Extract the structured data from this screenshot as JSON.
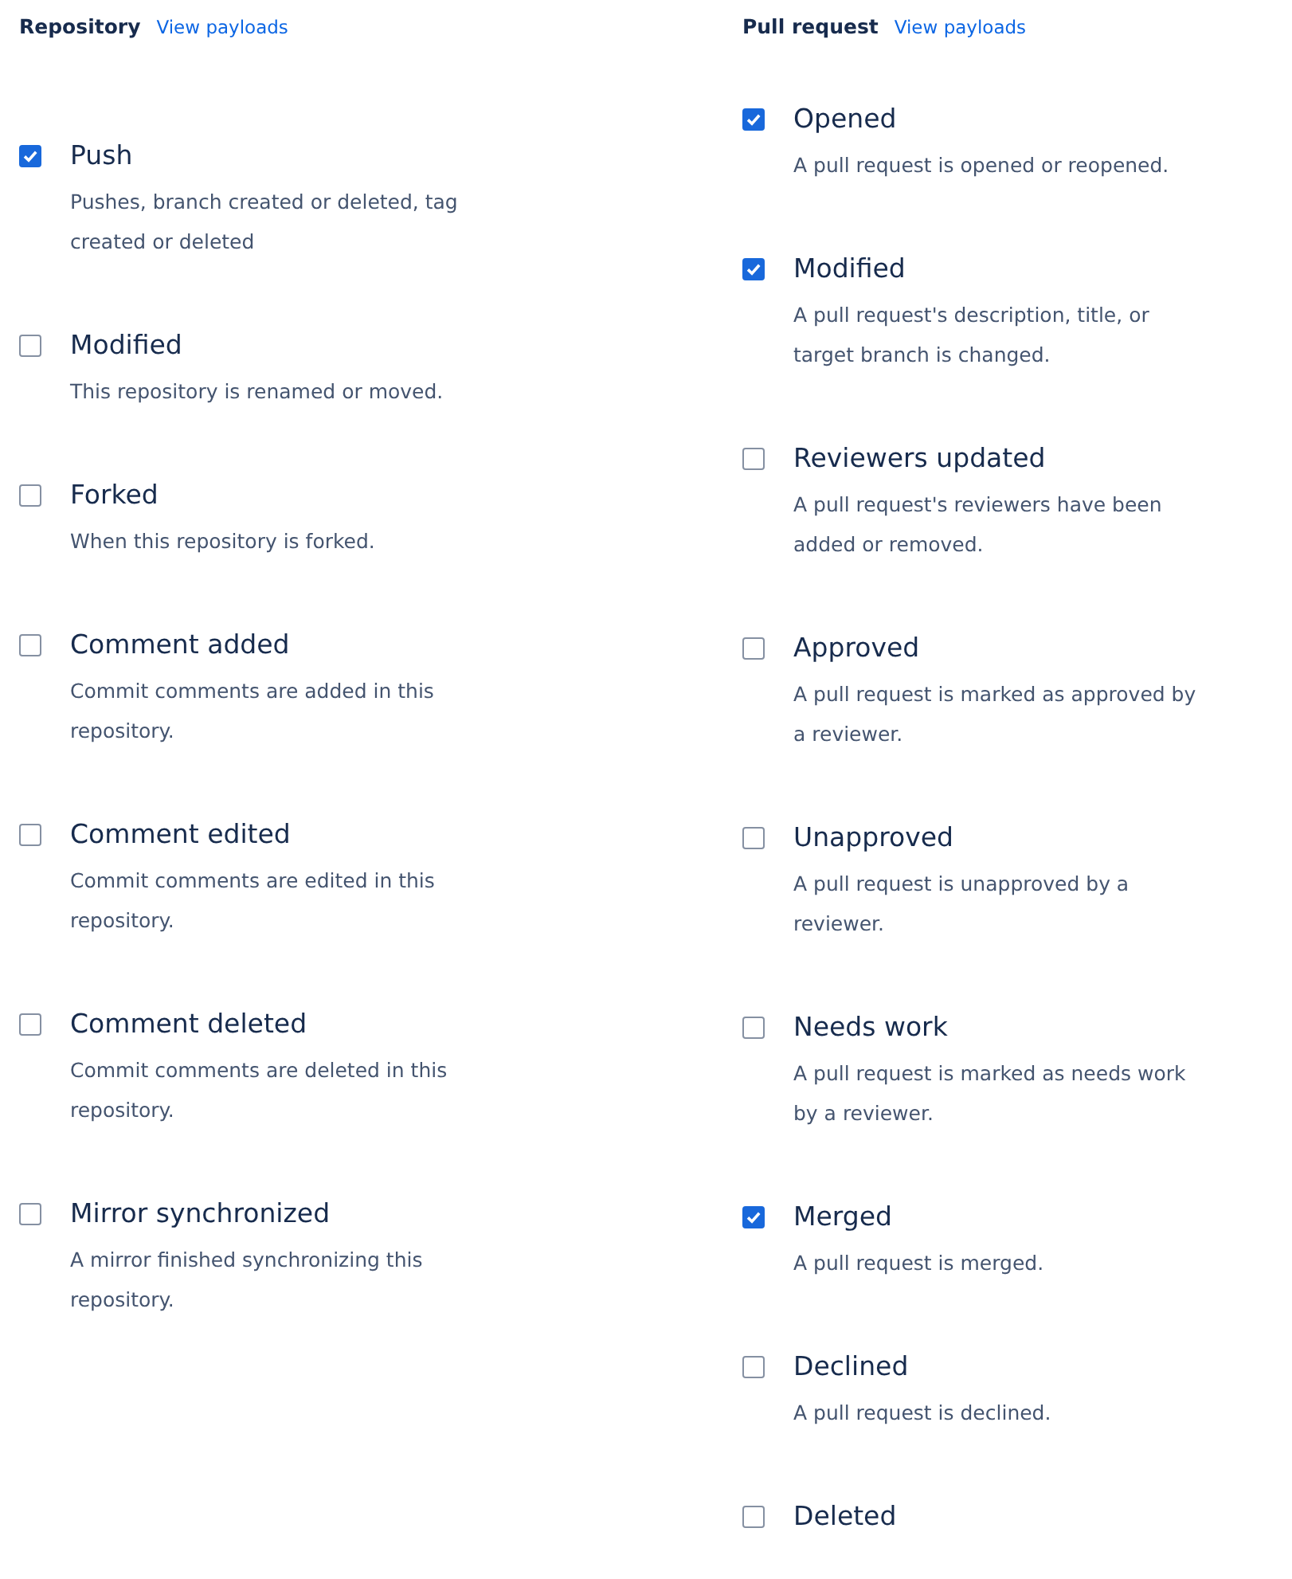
{
  "columns": [
    {
      "title": "Repository",
      "link": "View payloads",
      "events": [
        {
          "label": "Push",
          "checked": true,
          "description": [
            "Pushes, branch created or deleted, tag",
            "created or deleted"
          ]
        },
        {
          "label": "Modified",
          "checked": false,
          "description": [
            "This repository is renamed or moved."
          ]
        },
        {
          "label": "Forked",
          "checked": false,
          "description": [
            "When this repository is forked."
          ]
        },
        {
          "label": "Comment added",
          "checked": false,
          "description": [
            "Commit comments are added in this",
            "repository."
          ]
        },
        {
          "label": "Comment edited",
          "checked": false,
          "description": [
            "Commit comments are edited in this",
            "repository."
          ]
        },
        {
          "label": "Comment deleted",
          "checked": false,
          "description": [
            "Commit comments are deleted in this",
            "repository."
          ]
        },
        {
          "label": "Mirror synchronized",
          "checked": false,
          "description": [
            "A mirror finished synchronizing this",
            "repository."
          ]
        }
      ]
    },
    {
      "title": "Pull request",
      "link": "View payloads",
      "events": [
        {
          "label": "Opened",
          "checked": true,
          "description": [
            "A pull request is opened or reopened."
          ]
        },
        {
          "label": "Modified",
          "checked": true,
          "description": [
            "A pull request's description, title, or",
            "target branch is changed."
          ]
        },
        {
          "label": "Reviewers updated",
          "checked": false,
          "description": [
            "A pull request's reviewers have been",
            "added or removed."
          ]
        },
        {
          "label": "Approved",
          "checked": false,
          "description": [
            "A pull request is marked as approved by",
            "a reviewer."
          ]
        },
        {
          "label": "Unapproved",
          "checked": false,
          "description": [
            "A pull request is unapproved by a",
            "reviewer."
          ]
        },
        {
          "label": "Needs work",
          "checked": false,
          "description": [
            "A pull request is marked as needs work",
            "by a reviewer."
          ]
        },
        {
          "label": "Merged",
          "checked": true,
          "description": [
            "A pull request is merged."
          ]
        },
        {
          "label": "Declined",
          "checked": false,
          "description": [
            "A pull request is declined."
          ]
        },
        {
          "label": "Deleted",
          "checked": false
        }
      ]
    }
  ]
}
